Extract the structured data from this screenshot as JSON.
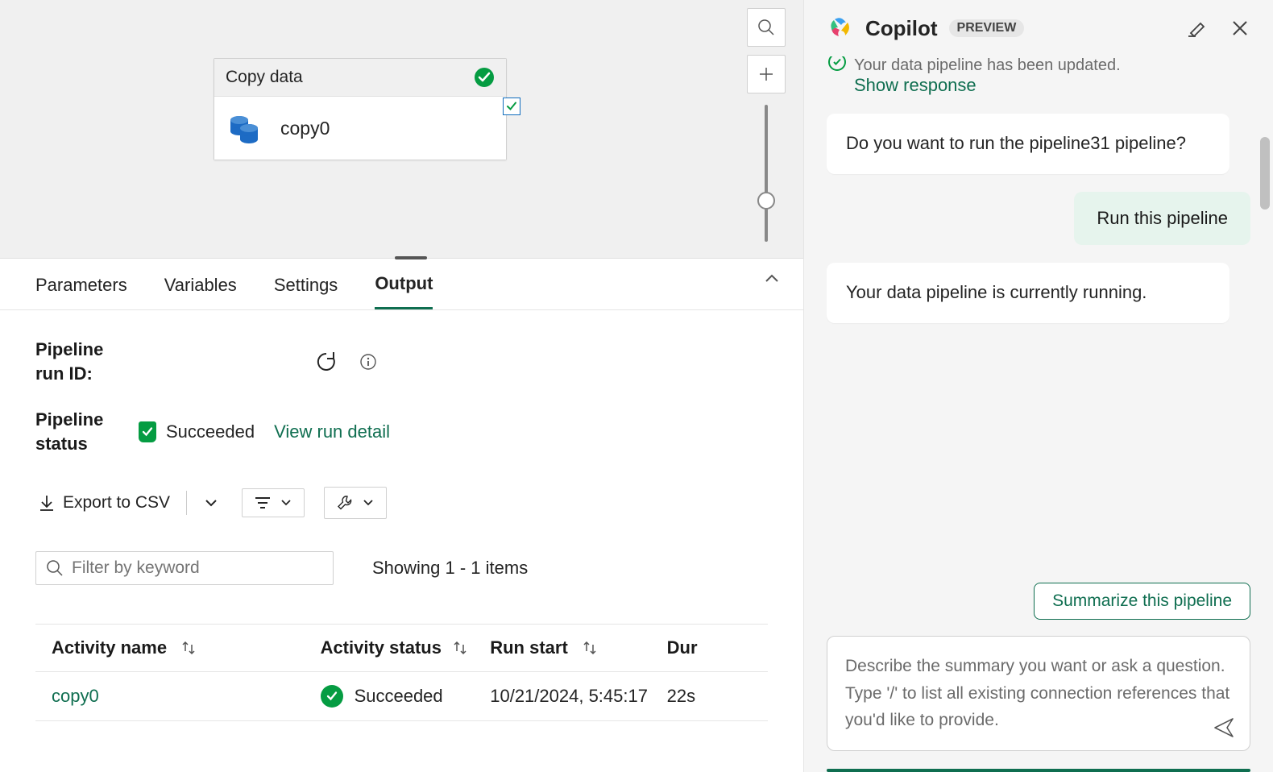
{
  "canvas": {
    "activity_title": "Copy data",
    "activity_name": "copy0"
  },
  "tabs": {
    "parameters": "Parameters",
    "variables": "Variables",
    "settings": "Settings",
    "output": "Output"
  },
  "output": {
    "run_id_label": "Pipeline run ID:",
    "status_label": "Pipeline status",
    "status_value": "Succeeded",
    "view_run_detail": "View run detail",
    "export_csv": "Export to CSV",
    "filter_placeholder": "Filter by keyword",
    "showing": "Showing 1 - 1 items",
    "columns": {
      "activity_name": "Activity name",
      "activity_status": "Activity status",
      "run_start": "Run start",
      "duration": "Dur"
    },
    "rows": [
      {
        "name": "copy0",
        "status": "Succeeded",
        "start": "10/21/2024, 5:45:17",
        "duration": "22s"
      }
    ]
  },
  "copilot": {
    "title": "Copilot",
    "badge": "PREVIEW",
    "truncated_msg": "Your data pipeline has been updated.",
    "show_response": "Show response",
    "msg_question": "Do you want to run the pipeline31 pipeline?",
    "action": "Run this pipeline",
    "msg_running": "Your data pipeline is currently running.",
    "suggestion": "Summarize this pipeline",
    "input_placeholder": "Describe the summary you want or ask a question.\nType '/' to list all existing connection references that you'd like to provide."
  }
}
